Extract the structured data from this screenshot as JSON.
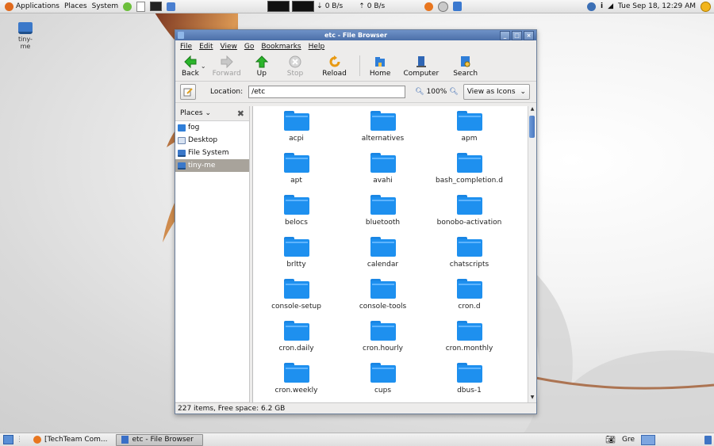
{
  "top_panel": {
    "applications": "Applications",
    "places": "Places",
    "system": "System",
    "net_down": "0 B/s",
    "net_up": "0 B/s",
    "clock": "Tue Sep 18, 12:29 AM"
  },
  "desktop": {
    "icon_label": "tiny-\nme"
  },
  "window": {
    "title": "etc - File Browser",
    "menu": [
      "File",
      "Edit",
      "View",
      "Go",
      "Bookmarks",
      "Help"
    ],
    "toolbar": {
      "back": "Back",
      "forward": "Forward",
      "up": "Up",
      "stop": "Stop",
      "reload": "Reload",
      "home": "Home",
      "computer": "Computer",
      "search": "Search"
    },
    "location_label": "Location:",
    "location_value": "/etc",
    "zoom": "100%",
    "view_mode": "View as Icons",
    "sidebar": {
      "header": "Places",
      "items": [
        "fog",
        "Desktop",
        "File System",
        "tiny-me"
      ]
    },
    "folders": [
      "acpi",
      "alternatives",
      "apm",
      "apt",
      "avahi",
      "bash_completion.d",
      "belocs",
      "bluetooth",
      "bonobo-activation",
      "brltty",
      "calendar",
      "chatscripts",
      "console-setup",
      "console-tools",
      "cron.d",
      "cron.daily",
      "cron.hourly",
      "cron.monthly",
      "cron.weekly",
      "cups",
      "dbus-1"
    ],
    "status": "227 items, Free space: 6.2 GB"
  },
  "bottom_panel": {
    "task1": "[TechTeam Com...",
    "task2": "etc - File Browser",
    "keyboard": "Gre"
  },
  "colors": {
    "folder": "#1e90ef",
    "titlebar": "#5a7fb8",
    "selected_place": "#a8a39b"
  }
}
